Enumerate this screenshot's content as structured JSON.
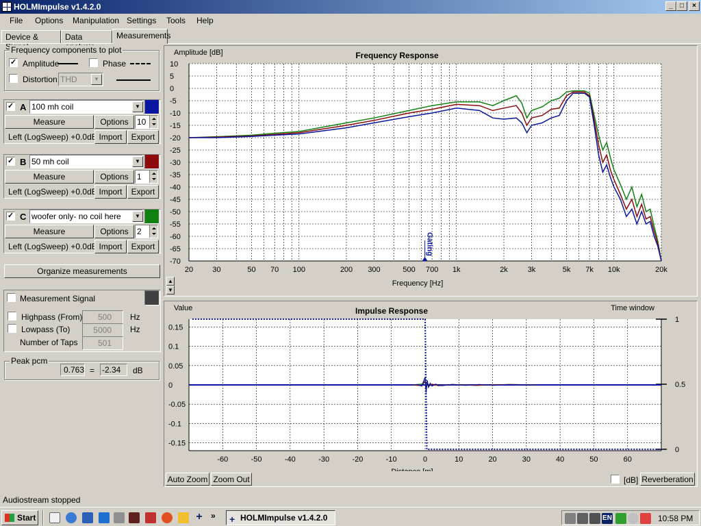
{
  "window": {
    "title": "HOLMImpulse  v1.4.2.0",
    "btn_min": "_",
    "btn_max": "□",
    "btn_close": "×"
  },
  "menu": [
    "File",
    "Options",
    "Manipulation",
    "Settings",
    "Tools",
    "Help"
  ],
  "tabs": [
    "Device & Signal",
    "Data analysis",
    "Measurements"
  ],
  "freq_components": {
    "title": "Frequency components to plot",
    "amplitude_label": "Amplitude",
    "amplitude_checked": "✓",
    "phase_label": "Phase",
    "phase_checked": "",
    "distortion_label": "Distortion",
    "distortion_checked": "",
    "distortion_type": "THD"
  },
  "measurements": [
    {
      "letter": "A",
      "checked": "✓",
      "name": "100 mh coil",
      "color": "#0a16a0",
      "measure": "Measure",
      "options": "Options",
      "count": "10",
      "source": "Left (LogSweep) +0.0dB",
      "import": "Import",
      "export": "Export"
    },
    {
      "letter": "B",
      "checked": "✓",
      "name": "50 mh coil",
      "color": "#8c0a0a",
      "measure": "Measure",
      "options": "Options",
      "count": "1",
      "source": "Left (LogSweep) +0.0dB",
      "import": "Import",
      "export": "Export"
    },
    {
      "letter": "C",
      "checked": "✓",
      "name": "woofer only- no coil here",
      "color": "#108010",
      "measure": "Measure",
      "options": "Options",
      "count": "2",
      "source": "Left (LogSweep) +0.0dB",
      "import": "Import",
      "export": "Export"
    }
  ],
  "organize_button": "Organize measurements",
  "signal": {
    "title": "Measurement Signal",
    "checked": "",
    "color": "#404040",
    "highpass_label": "Highpass (From)",
    "highpass_value": "500",
    "highpass_unit": "Hz",
    "lowpass_label": "Lowpass (To)",
    "lowpass_value": "5000",
    "lowpass_unit": "Hz",
    "taps_label": "Number of Taps",
    "taps_value": "501"
  },
  "peak": {
    "title": "Peak pcm",
    "pcm_value": "0.763",
    "equals": "=",
    "db_value": "-2.34",
    "db_unit": "dB"
  },
  "freq_chart": {
    "title": "Frequency Response",
    "ylabel": "Amplitude [dB]",
    "xlabel": "Frequency [Hz]",
    "gating_label": "Gating",
    "y_ticks": [
      "10",
      "5",
      "0",
      "-5",
      "-10",
      "-15",
      "-20",
      "-25",
      "-30",
      "-35",
      "-40",
      "-45",
      "-50",
      "-55",
      "-60",
      "-65",
      "-70"
    ],
    "x_ticks": [
      "20",
      "30",
      "50",
      "70",
      "100",
      "200",
      "300",
      "500",
      "700",
      "1k",
      "2k",
      "3k",
      "5k",
      "7k",
      "10k",
      "20k"
    ]
  },
  "impulse_chart": {
    "title": "Impulse Response",
    "ylabel": "Value",
    "right_label": "Time window",
    "xlabel": "Distance [m]",
    "y_ticks": [
      "0.15",
      "0.1",
      "0.05",
      "0",
      "-0.05",
      "-0.1",
      "-0.15"
    ],
    "x_ticks": [
      "-60",
      "-50",
      "-40",
      "-30",
      "-20",
      "-10",
      "0",
      "10",
      "20",
      "30",
      "40",
      "50",
      "60"
    ],
    "window_ticks": [
      "1",
      "0.5",
      "0"
    ],
    "auto_zoom": "Auto Zoom",
    "zoom_out": "Zoom Out",
    "db_label": "[dB]",
    "db_checked": "",
    "reverberation": "Reverberation"
  },
  "chart_data": [
    {
      "type": "line",
      "title": "Frequency Response",
      "xlabel": "Frequency [Hz]",
      "ylabel": "Amplitude [dB]",
      "xscale": "log",
      "xlim": [
        20,
        20000
      ],
      "ylim": [
        -70,
        10
      ],
      "grid": true,
      "gating_marker_hz": 630,
      "series": [
        {
          "name": "100 mh coil",
          "color": "#0a16a0",
          "x": [
            20,
            30,
            50,
            70,
            100,
            200,
            300,
            500,
            700,
            1000,
            1400,
            1700,
            2000,
            2400,
            2600,
            2800,
            3000,
            3500,
            4000,
            4500,
            5000,
            5500,
            6000,
            6500,
            7000,
            7500,
            8000,
            8500,
            9000,
            9500,
            10000,
            11000,
            12000,
            13000,
            14000,
            15000,
            16000,
            17000,
            18000,
            19000,
            20000
          ],
          "y": [
            -20,
            -20,
            -19.5,
            -19,
            -18.5,
            -16,
            -14,
            -11.5,
            -10,
            -8,
            -9,
            -12,
            -12.5,
            -12,
            -14,
            -18,
            -15,
            -14,
            -12,
            -11,
            -5,
            -2,
            -2,
            -2,
            -3.5,
            -15,
            -27,
            -34,
            -31,
            -36,
            -40,
            -45,
            -52,
            -49,
            -55,
            -50,
            -55,
            -54,
            -60,
            -64,
            -70
          ]
        },
        {
          "name": "50 mh coil",
          "color": "#8c0a0a",
          "x": [
            20,
            30,
            50,
            70,
            100,
            200,
            300,
            500,
            700,
            1000,
            1400,
            1700,
            2000,
            2400,
            2600,
            2800,
            3000,
            3500,
            4000,
            4500,
            5000,
            5500,
            6000,
            6500,
            7000,
            7500,
            8000,
            8500,
            9000,
            9500,
            10000,
            11000,
            12000,
            13000,
            14000,
            15000,
            16000,
            17000,
            18000,
            19000,
            20000
          ],
          "y": [
            -20,
            -19.8,
            -19.3,
            -18.7,
            -18,
            -15,
            -13,
            -10,
            -8.5,
            -6.5,
            -7,
            -9,
            -8,
            -7,
            -10,
            -15,
            -12,
            -11,
            -8.5,
            -8,
            -3,
            -1.5,
            -1.5,
            -1.5,
            -3,
            -13,
            -23,
            -30,
            -27,
            -33,
            -37,
            -43,
            -49,
            -45,
            -52,
            -47,
            -53,
            -52,
            -58,
            -63,
            -70
          ]
        },
        {
          "name": "woofer only- no coil here",
          "color": "#108010",
          "x": [
            20,
            30,
            50,
            70,
            100,
            200,
            300,
            500,
            700,
            1000,
            1400,
            1700,
            2000,
            2400,
            2600,
            2800,
            3000,
            3500,
            4000,
            4500,
            5000,
            5500,
            6000,
            6500,
            7000,
            7500,
            8000,
            8500,
            9000,
            9500,
            10000,
            11000,
            12000,
            13000,
            14000,
            15000,
            16000,
            17000,
            18000,
            19000,
            20000
          ],
          "y": [
            -20,
            -19.6,
            -19,
            -18.2,
            -17.5,
            -14,
            -12,
            -9,
            -7,
            -5.5,
            -5.5,
            -7,
            -5,
            -3,
            -6,
            -12,
            -9,
            -7.5,
            -5,
            -4,
            -1.5,
            -1,
            -1,
            -1,
            -2,
            -11,
            -19,
            -25,
            -22,
            -28,
            -33,
            -39,
            -45,
            -40,
            -48,
            -43,
            -50,
            -49,
            -56,
            -62,
            -70
          ]
        }
      ]
    },
    {
      "type": "line",
      "title": "Impulse Response",
      "xlabel": "Distance [m]",
      "ylabel": "Value",
      "xlim": [
        -70,
        70
      ],
      "ylim": [
        -0.17,
        0.17
      ],
      "grid": true,
      "time_window_ylim": [
        0,
        1
      ],
      "time_window": {
        "x": [
          -69,
          0,
          0,
          0.5,
          0.5,
          70
        ],
        "y": [
          1,
          1,
          1,
          0,
          0,
          0
        ]
      },
      "series": [
        {
          "name": "100 mh coil",
          "color": "#0a16a0",
          "x": [
            -70,
            -4,
            -2,
            -1,
            -0.5,
            0,
            0.3,
            0.6,
            1,
            1.5,
            2,
            3,
            5,
            8,
            12,
            16,
            20,
            25,
            30,
            70
          ],
          "y": [
            0,
            0,
            0.001,
            -0.003,
            0.008,
            0.02,
            -0.02,
            0.012,
            -0.006,
            0.004,
            -0.003,
            0.002,
            -0.002,
            0.001,
            -0.001,
            0.001,
            -0.001,
            0.0005,
            0,
            0
          ]
        },
        {
          "name": "50 mh coil",
          "color": "#8c0a0a",
          "x": [
            -4,
            -1,
            0,
            0.3,
            0.6,
            1,
            2,
            4,
            8,
            15,
            25,
            33
          ],
          "y": [
            0,
            -0.002,
            0.01,
            -0.012,
            0.006,
            -0.004,
            0.002,
            -0.002,
            0.001,
            -0.001,
            0.001,
            0
          ]
        },
        {
          "name": "woofer only- no coil here",
          "color": "#108010",
          "x": [
            -4,
            -1,
            0,
            0.3,
            0.6,
            1,
            2,
            4,
            8,
            15,
            25,
            33
          ],
          "y": [
            0,
            0.002,
            0.008,
            -0.014,
            0.006,
            -0.003,
            0.002,
            -0.002,
            0.001,
            -0.001,
            0.001,
            0
          ]
        }
      ]
    }
  ],
  "status_bar": "Audiostream stopped",
  "taskbar": {
    "start": "Start",
    "task_item": "HOLMImpulse  v1.4.2.0",
    "clock": "10:58 PM",
    "lang": "EN",
    "more": "»"
  }
}
